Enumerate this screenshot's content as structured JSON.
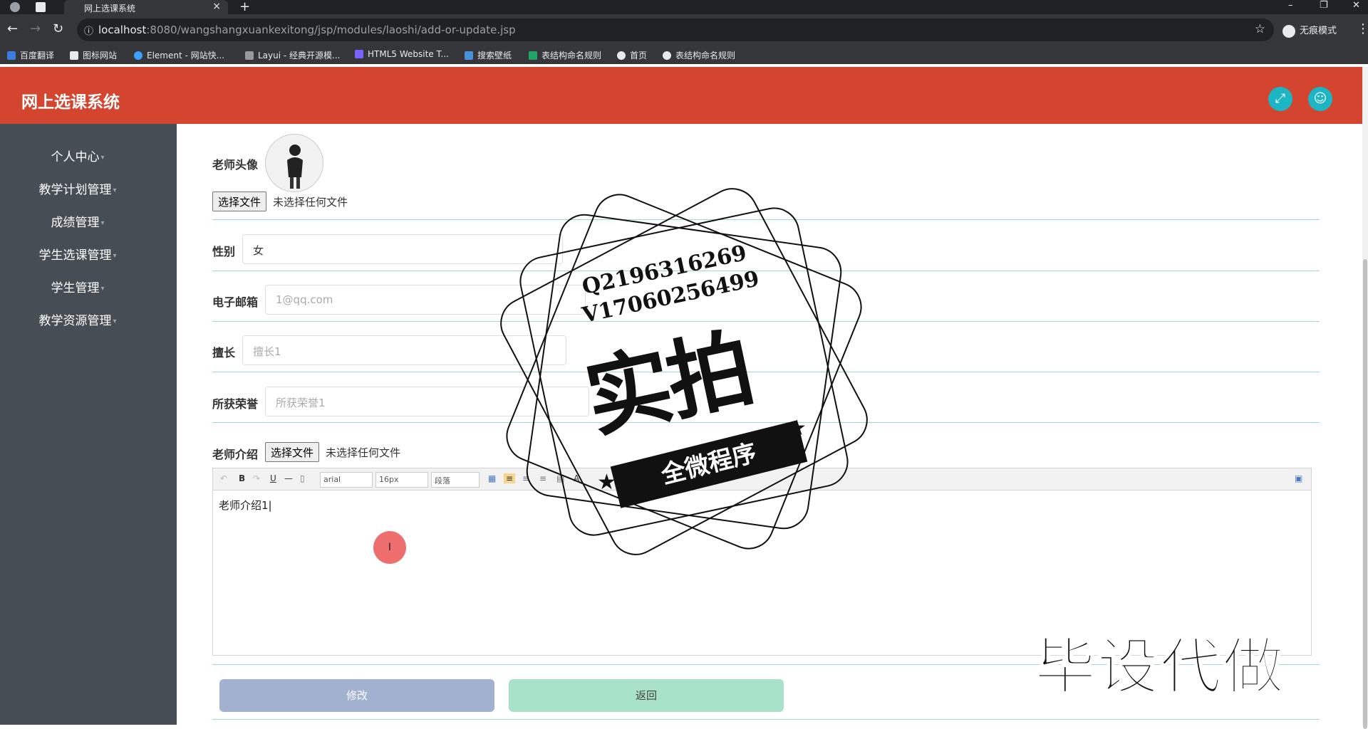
{
  "browser": {
    "tab_title": "网上选课系统",
    "url_host": "localhost",
    "url_path": ":8080/wangshangxuankexitong/jsp/modules/laoshi/add-or-update.jsp",
    "incognito_label": "无痕模式",
    "bookmarks": [
      "百度翻译",
      "图标网站",
      "Element - 网站快...",
      "Layui - 经典开源模...",
      "HTML5 Website T...",
      "搜索壁纸",
      "表结构命名规则",
      "首页",
      "表结构命名规则"
    ]
  },
  "header": {
    "title": "网上选课系统"
  },
  "sidebar": {
    "items": [
      {
        "label": "个人中心"
      },
      {
        "label": "教学计划管理"
      },
      {
        "label": "成绩管理"
      },
      {
        "label": "学生选课管理"
      },
      {
        "label": "学生管理"
      },
      {
        "label": "教学资源管理"
      }
    ]
  },
  "form": {
    "avatar_label": "老师头像",
    "choose_file": "选择文件",
    "no_file": "未选择任何文件",
    "gender_label": "性别",
    "gender_value": "女",
    "email_label": "电子邮箱",
    "email_value": "1@qq.com",
    "specialty_label": "擅长",
    "specialty_value": "擅长1",
    "honors_label": "所获荣誉",
    "honors_value": "所获荣誉1",
    "intro_label": "老师介绍",
    "intro_content": "老师介绍1",
    "toolbar": {
      "font": "arial",
      "size": "16px",
      "para": "段落"
    },
    "submit_label": "修改",
    "back_label": "返回"
  },
  "watermark": {
    "qq": "Q2196316269",
    "wechat": "V17060256499",
    "big": "实拍",
    "ribbon": "全微程序",
    "corner": "毕设代做"
  },
  "colors": {
    "header": "#d3452f",
    "sidebar": "#474d54",
    "accent": "#1bb5c4",
    "submit_btn": "#a3b1d0",
    "back_btn": "#a8e2c8"
  }
}
